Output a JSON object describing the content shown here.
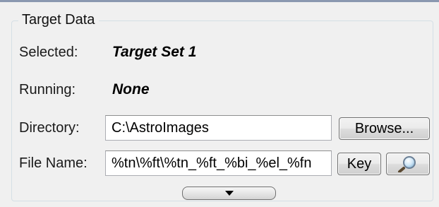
{
  "group": {
    "title": "Target Data"
  },
  "selected": {
    "label": "Selected:",
    "value": "Target Set 1"
  },
  "running": {
    "label": "Running:",
    "value": "None"
  },
  "directory": {
    "label": "Directory:",
    "value": "C:\\AstroImages",
    "browse_label": "Browse..."
  },
  "file_name": {
    "label": "File Name:",
    "value": "%tn\\%ft\\%tn_%ft_%bi_%el_%fn",
    "key_label": "Key"
  },
  "icons": {
    "preview": "magnifier-icon",
    "expander": "chevron-down-icon"
  }
}
